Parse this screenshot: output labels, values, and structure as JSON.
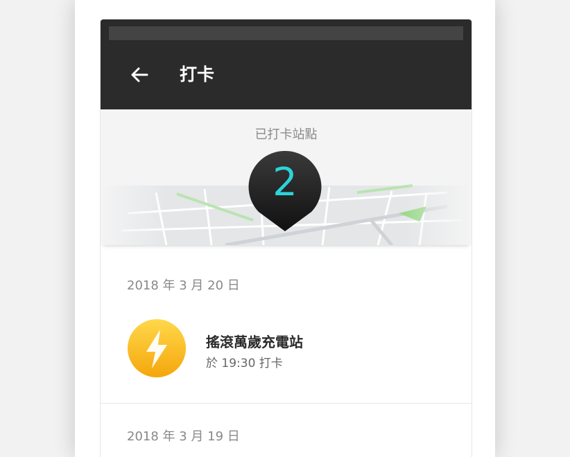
{
  "app_bar": {
    "title": "打卡",
    "back_icon": "arrow-left-icon"
  },
  "hero": {
    "label": "已打卡站點",
    "count": "2"
  },
  "groups": [
    {
      "date": "2018 年 3 月 20 日",
      "entries": [
        {
          "name": "搖滾萬歲充電站",
          "time": "於 19:30 打卡",
          "icon": "lightning-bolt-icon"
        }
      ]
    },
    {
      "date": "2018 年 3 月 19 日",
      "entries": []
    }
  ],
  "colors": {
    "app_bar": "#2b2b2b",
    "count": "#2cd3d9",
    "bolt_badge": "#ffc21a"
  }
}
